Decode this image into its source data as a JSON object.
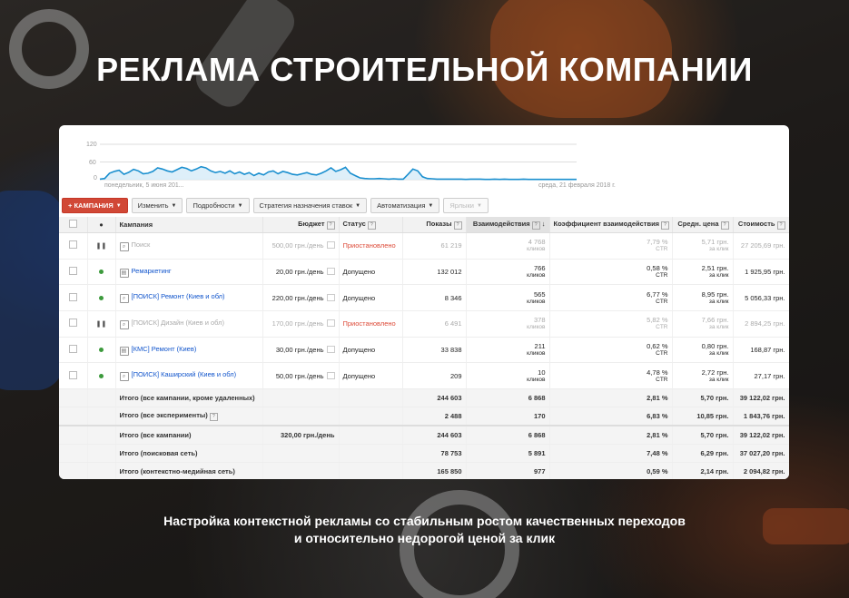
{
  "headline": "РЕКЛАМА СТРОИТЕЛЬНОЙ КОМПАНИИ",
  "caption": {
    "line1": "Настройка контекстной рекламы со стабильным ростом качественных переходов",
    "line2": "и относительно недорогой ценой за клик"
  },
  "graph": {
    "y_ticks": [
      "120",
      "60",
      "0"
    ],
    "start_label": "понедельник, 5 июня 201...",
    "end_label": "среда, 21 февраля 2018 г.",
    "color": "#1a8fcf",
    "values": [
      2,
      4,
      22,
      28,
      32,
      18,
      25,
      35,
      30,
      20,
      22,
      28,
      40,
      36,
      30,
      26,
      34,
      42,
      38,
      30,
      36,
      44,
      40,
      30,
      24,
      28,
      22,
      30,
      20,
      26,
      18,
      24,
      14,
      22,
      16,
      26,
      30,
      20,
      28,
      24,
      18,
      16,
      20,
      24,
      18,
      16,
      22,
      30,
      40,
      28,
      34,
      42,
      22,
      14,
      6,
      4,
      3,
      3,
      4,
      3,
      2,
      3,
      2,
      2,
      18,
      36,
      30,
      10,
      4,
      3,
      2,
      2,
      2,
      2,
      2,
      2,
      1,
      2,
      2,
      2,
      1,
      1,
      2,
      1,
      2,
      1,
      1,
      1,
      2,
      1,
      1,
      1,
      1,
      1,
      1,
      1,
      1,
      1,
      1,
      1
    ]
  },
  "toolbar": {
    "campaign": "+ КАМПАНИЯ",
    "edit": "Изменить",
    "details": "Подробности",
    "bidding": "Стратегия назначения ставок",
    "automation": "Автоматизация",
    "labels": "Ярлыки"
  },
  "columns": {
    "campaign": "Кампания",
    "budget": "Бюджет",
    "status": "Статус",
    "impressions": "Показы",
    "interactions": "Взаимодействия",
    "rate": "Коэффициент взаимодействия",
    "avg_cost": "Средн. цена",
    "cost": "Стоимость"
  },
  "rows": [
    {
      "paused": true,
      "name": "Поиск",
      "budget": "500,00 грн./день",
      "status": "Приостановлено",
      "impressions": "61 219",
      "inter": "4 768",
      "inter_unit": "кликов",
      "rate": "7,79 %",
      "rate_unit": "CTR",
      "avg": "5,71 грн.",
      "avg_unit": "за клик",
      "cost": "27 205,69 грн."
    },
    {
      "paused": false,
      "name": "Ремаркетинг",
      "budget": "20,00 грн./день",
      "status": "Допущено",
      "impressions": "132 012",
      "inter": "766",
      "inter_unit": "кликов",
      "rate": "0,58 %",
      "rate_unit": "CTR",
      "avg": "2,51 грн.",
      "avg_unit": "за клик",
      "cost": "1 925,95 грн."
    },
    {
      "paused": false,
      "name": "[ПОИСК] Ремонт (Киев и обл)",
      "budget": "220,00 грн./день",
      "status": "Допущено",
      "impressions": "8 346",
      "inter": "565",
      "inter_unit": "кликов",
      "rate": "6,77 %",
      "rate_unit": "CTR",
      "avg": "8,95 грн.",
      "avg_unit": "за клик",
      "cost": "5 056,33 грн."
    },
    {
      "paused": true,
      "name": "[ПОИСК] Дизайн (Киев и обл)",
      "budget": "170,00 грн./день",
      "status": "Приостановлено",
      "impressions": "6 491",
      "inter": "378",
      "inter_unit": "кликов",
      "rate": "5,82 %",
      "rate_unit": "CTR",
      "avg": "7,66 грн.",
      "avg_unit": "за клик",
      "cost": "2 894,25 грн."
    },
    {
      "paused": false,
      "name": "[КМС] Ремонт (Киев)",
      "budget": "30,00 грн./день",
      "status": "Допущено",
      "impressions": "33 838",
      "inter": "211",
      "inter_unit": "кликов",
      "rate": "0,62 %",
      "rate_unit": "CTR",
      "avg": "0,80 грн.",
      "avg_unit": "за клик",
      "cost": "168,87 грн."
    },
    {
      "paused": false,
      "name": "[ПОИСК] Каширский (Киев и обл)",
      "budget": "50,00 грн./день",
      "status": "Допущено",
      "impressions": "209",
      "inter": "10",
      "inter_unit": "кликов",
      "rate": "4,78 %",
      "rate_unit": "CTR",
      "avg": "2,72 грн.",
      "avg_unit": "за клик",
      "cost": "27,17 грн."
    }
  ],
  "totals": [
    {
      "label": "Итого (все кампании, кроме удаленных)",
      "budget": "",
      "impressions": "244 603",
      "inter": "6 868",
      "rate": "2,81 %",
      "avg": "5,70 грн.",
      "cost": "39 122,02 грн."
    },
    {
      "label": "Итого (все эксперименты)",
      "budget": "",
      "impressions": "2 488",
      "inter": "170",
      "rate": "6,83 %",
      "avg": "10,85 грн.",
      "cost": "1 843,76 грн."
    },
    {
      "label": "Итого (все кампании)",
      "budget": "320,00 грн./день",
      "impressions": "244 603",
      "inter": "6 868",
      "rate": "2,81 %",
      "avg": "5,70 грн.",
      "cost": "39 122,02 грн."
    },
    {
      "label": "Итого (поисковая сеть)",
      "budget": "",
      "impressions": "78 753",
      "inter": "5 891",
      "rate": "7,48 %",
      "avg": "6,29 грн.",
      "cost": "37 027,20 грн."
    },
    {
      "label": "Итого (контекстно-медийная сеть)",
      "budget": "",
      "impressions": "165 850",
      "inter": "977",
      "rate": "0,59 %",
      "avg": "2,14 грн.",
      "cost": "2 094,82 грн."
    }
  ]
}
